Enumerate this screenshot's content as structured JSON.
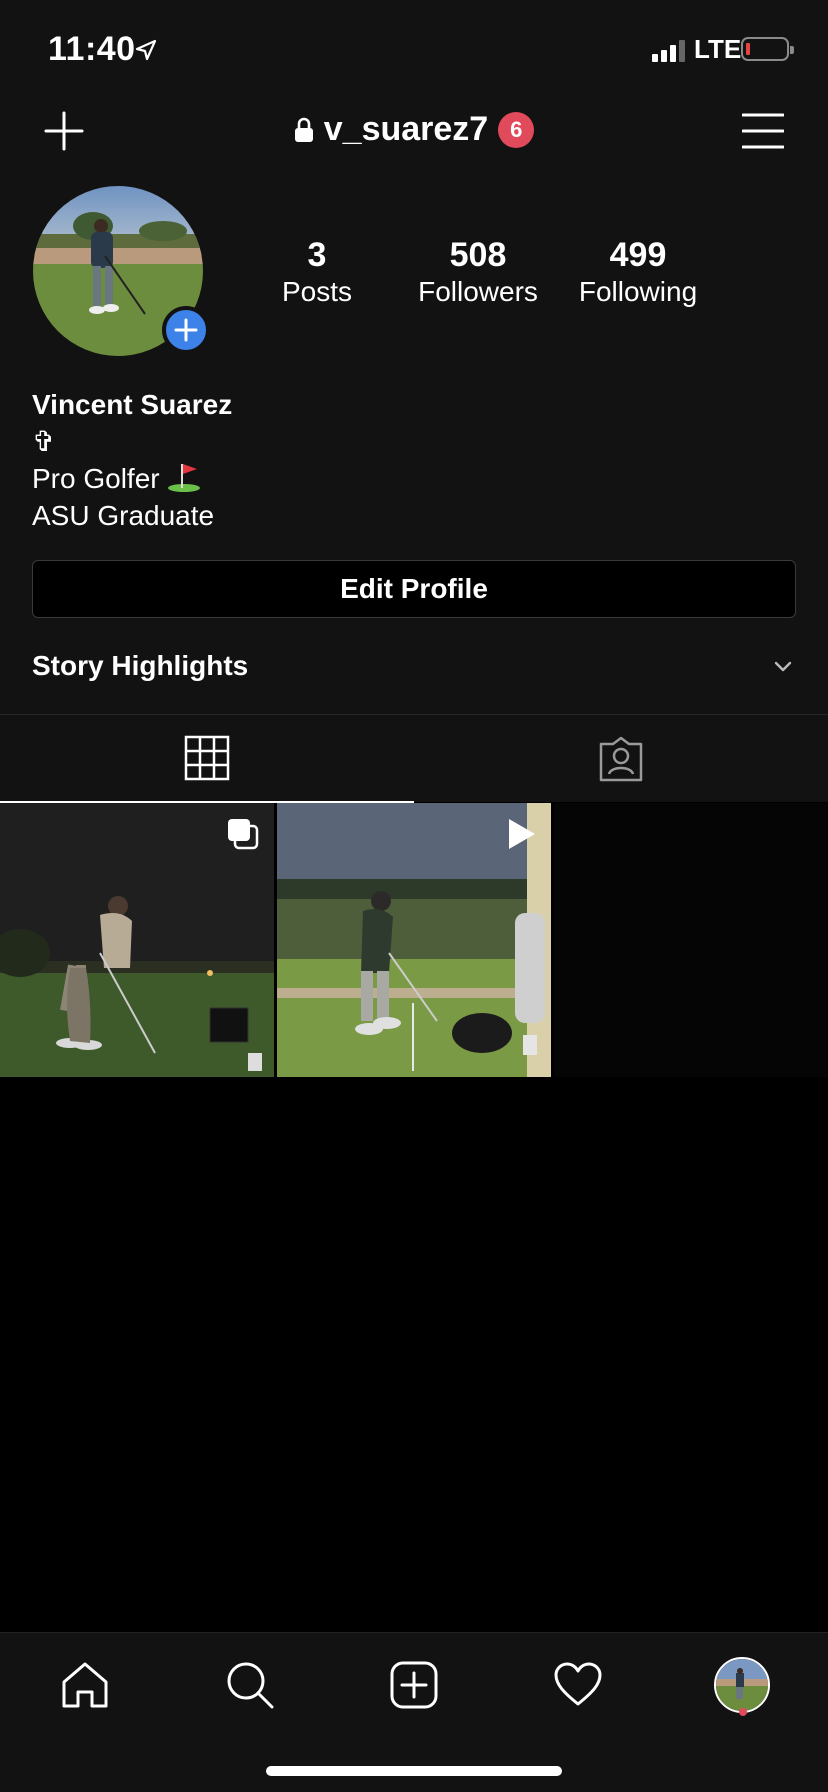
{
  "status_bar": {
    "time": "11:40",
    "network": "LTE"
  },
  "header": {
    "username": "v_suarez7",
    "notification_count": "6"
  },
  "profile": {
    "stats": [
      {
        "value": "3",
        "label": "Posts"
      },
      {
        "value": "508",
        "label": "Followers"
      },
      {
        "value": "499",
        "label": "Following"
      }
    ],
    "name": "Vincent Suarez",
    "bio_lines": [
      "✞",
      "Pro Golfer",
      "ASU Graduate"
    ],
    "edit_button": "Edit Profile",
    "story_highlights": "Story Highlights"
  },
  "colors": {
    "background": "#121212",
    "accent_blue": "#3c82e8",
    "badge_red": "#e04a5a"
  },
  "icons": {
    "header_left": "plus-icon",
    "header_right": "menu-icon",
    "tabs": [
      "grid-icon",
      "tagged-icon"
    ],
    "nav": [
      "home-icon",
      "search-icon",
      "new-post-icon",
      "heart-icon",
      "profile-avatar"
    ]
  }
}
